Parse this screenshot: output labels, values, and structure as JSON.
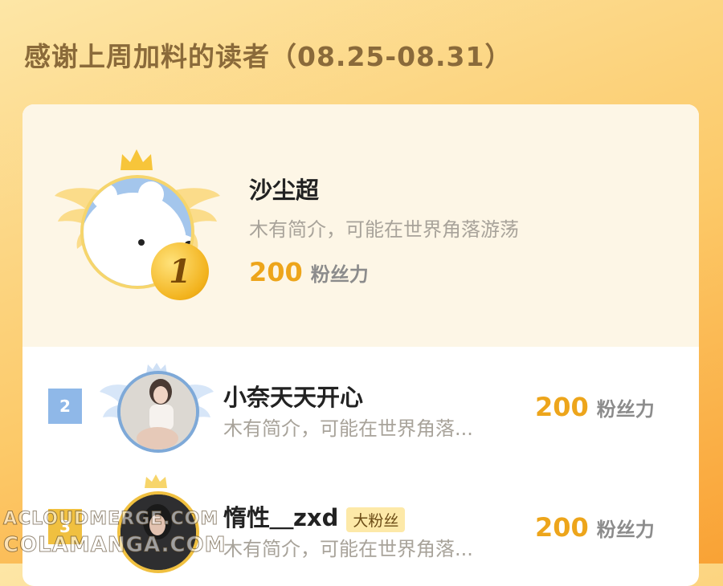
{
  "title": "感谢上周加料的读者（08.25-08.31）",
  "fan_unit": "粉丝力",
  "colors": {
    "accent": "#eda51b",
    "rank2": "#8fb8e8",
    "rank3": "#f0c040",
    "card_bg": "#fdf6e6"
  },
  "top_reader": {
    "rank": "1",
    "name": "沙尘超",
    "bio": "木有简介，可能在世界角落游荡",
    "fan_power": "200"
  },
  "readers": [
    {
      "rank": "2",
      "name": "小奈天天开心",
      "tag": "",
      "bio": "木有简介，可能在世界角落...",
      "fan_power": "200"
    },
    {
      "rank": "3",
      "name": "惰性＿zxd",
      "tag": "大粉丝",
      "bio": "木有简介，可能在世界角落...",
      "fan_power": "200"
    }
  ],
  "watermark": {
    "line1": "ACLOUDMERGE.COM",
    "line2": "COLAMANGA.COM"
  }
}
